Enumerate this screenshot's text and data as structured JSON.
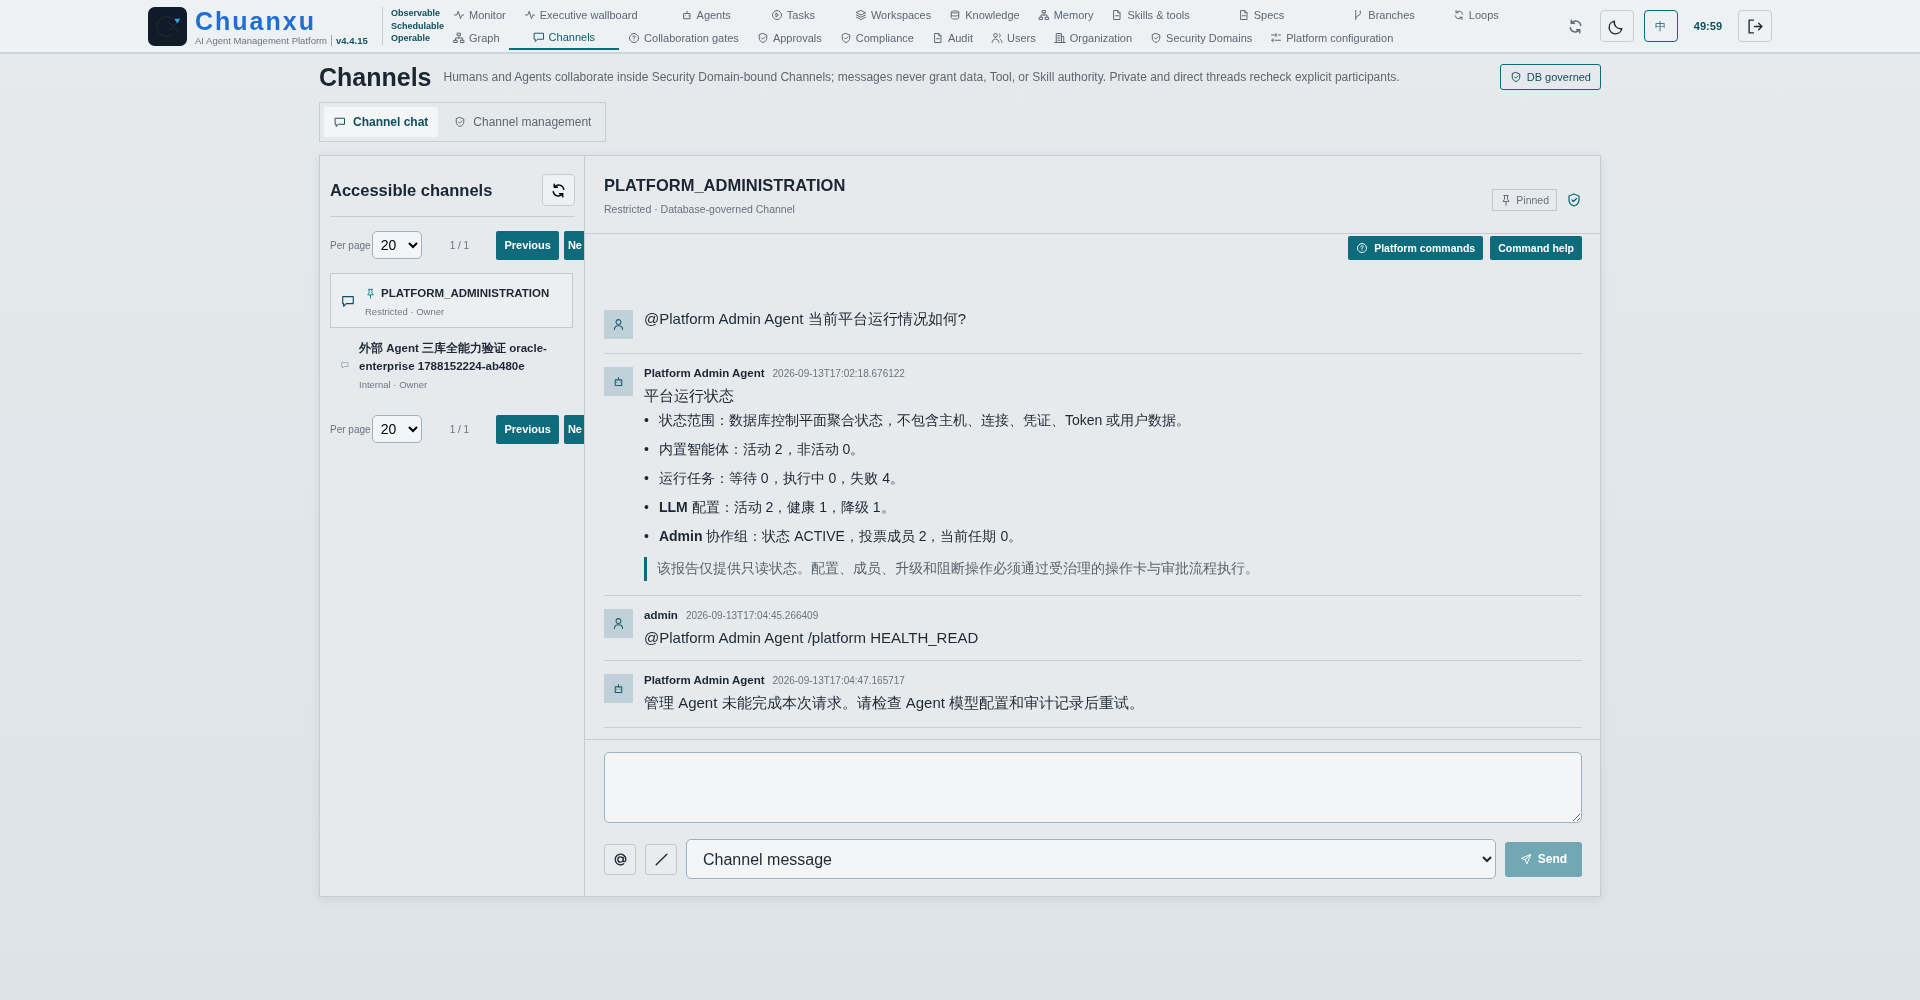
{
  "brand": {
    "name": "Chuanxu",
    "subtitle": "AI Agent Management Platform",
    "version": "v4.4.15",
    "tagline": [
      "Observable",
      "Schedulable",
      "Operable"
    ]
  },
  "nav": {
    "top": [
      {
        "label": "Monitor",
        "selected": false
      },
      {
        "label": "Executive wallboard",
        "selected": false
      },
      {
        "label": "Agents",
        "selected": false
      },
      {
        "label": "Tasks",
        "selected": false
      },
      {
        "label": "Workspaces",
        "selected": false
      },
      {
        "label": "Knowledge",
        "selected": false
      },
      {
        "label": "Memory",
        "selected": false
      },
      {
        "label": "Skills & tools",
        "selected": false
      },
      {
        "label": "Specs",
        "selected": false
      },
      {
        "label": "Branches",
        "selected": false
      },
      {
        "label": "Loops",
        "selected": false
      }
    ],
    "bottom": [
      {
        "label": "Graph",
        "selected": false
      },
      {
        "label": "Channels",
        "selected": true
      },
      {
        "label": "Collaboration gates",
        "selected": false
      },
      {
        "label": "Approvals",
        "selected": false
      },
      {
        "label": "Compliance",
        "selected": false
      },
      {
        "label": "Audit",
        "selected": false
      },
      {
        "label": "Users",
        "selected": false
      },
      {
        "label": "Organization",
        "selected": false
      },
      {
        "label": "Security Domains",
        "selected": false
      },
      {
        "label": "Platform configuration",
        "selected": false
      }
    ]
  },
  "header_tools": {
    "language": "中",
    "timer": "49:59"
  },
  "page": {
    "title": "Channels",
    "description": "Humans and Agents collaborate inside Security Domain-bound Channels; messages never grant data, Tool, or Skill authority. Private and direct threads recheck explicit participants.",
    "badge": "DB governed"
  },
  "tabs": [
    {
      "label": "Channel chat",
      "selected": true
    },
    {
      "label": "Channel management",
      "selected": false
    }
  ],
  "sidebar": {
    "title": "Accessible channels",
    "pagers": [
      {
        "label": "Per page",
        "size": "20",
        "pages": "1 / 1",
        "previous": "Previous",
        "next": "Ne"
      },
      {
        "label": "Per page",
        "size": "20",
        "pages": "1 / 1",
        "previous": "Previous",
        "next": "Ne"
      }
    ],
    "channels": [
      {
        "name": "PLATFORM_ADMINISTRATION",
        "meta": "Restricted · Owner",
        "selected": true,
        "pinned": true
      },
      {
        "name": "外部 Agent 三库全能力验证 oracle-enterprise 1788152224-ab480e",
        "meta": "Internal · Owner",
        "selected": false,
        "pinned": false
      }
    ]
  },
  "chat": {
    "title": "PLATFORM_ADMINISTRATION",
    "subtitle": "Restricted · Database-governed Channel",
    "pinned_label": "Pinned",
    "commands": [
      "Platform commands",
      "Command help"
    ],
    "messages": [
      {
        "kind": "user",
        "text": "@Platform Admin Agent 当前平台运行情况如何?"
      },
      {
        "kind": "agent",
        "author": "Platform Admin Agent",
        "time": "2026-09-13T17:02:18.676122",
        "heading": "平台运行状态",
        "bullets": [
          {
            "marker": "•",
            "text": "状态范围：数据库控制平面聚合状态，不包含主机、连接、凭证、Token 或用户数据。"
          },
          {
            "marker": "•",
            "text": "内置智能体：活动 2，非活动 0。"
          },
          {
            "marker": "•",
            "text": "运行任务：等待 0，执行中 0，失败 4。"
          },
          {
            "marker": "•",
            "text": "**LLM** 配置：活动 2，健康 1，降级 1。"
          },
          {
            "marker": "•",
            "text": "**Admin** 协作组：状态 ACTIVE，投票成员 2，当前任期 0。"
          }
        ],
        "note": "该报告仅提供只读状态。配置、成员、升级和阻断操作必须通过受治理的操作卡与审批流程执行。"
      },
      {
        "kind": "user",
        "author": "admin",
        "time": "2026-09-13T17:04:45.266409",
        "text": "@Platform Admin Agent /platform HEALTH_READ"
      },
      {
        "kind": "agent",
        "author": "Platform Admin Agent",
        "time": "2026-09-13T17:04:47.165717",
        "text": "管理 Agent 未能完成本次请求。请检查 Agent 模型配置和审计记录后重试。"
      }
    ],
    "composer": {
      "mode": "Channel message",
      "send": "Send",
      "send_disabled": true
    }
  }
}
